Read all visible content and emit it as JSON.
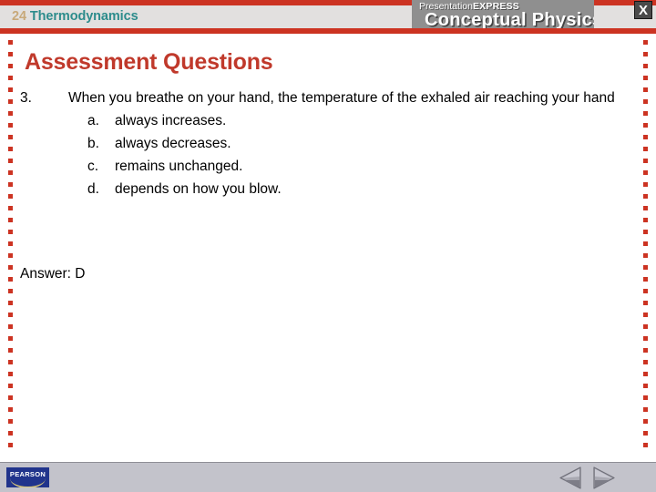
{
  "header": {
    "chapter_number": "24",
    "chapter_name": "Thermodynamics",
    "brand_prefix": "Presentation",
    "brand_suffix": "EXPRESS",
    "brand_product": "Conceptual Physics",
    "close_label": "X",
    "accent_color": "#cc3322",
    "chapter_number_color": "#c8a97a",
    "chapter_name_color": "#2d8c8c",
    "brand_plate_color": "#8f8f8f"
  },
  "slide": {
    "heading": "Assessment Questions",
    "heading_color": "#c0392b",
    "question": {
      "number": "3.",
      "text": "When you breathe on your hand, the temperature of the exhaled air reaching your hand",
      "choices": [
        {
          "letter": "a.",
          "text": "always increases."
        },
        {
          "letter": "b.",
          "text": "always decreases."
        },
        {
          "letter": "c.",
          "text": "remains unchanged."
        },
        {
          "letter": "d.",
          "text": "depends on how you blow."
        }
      ]
    },
    "answer": "Answer: D"
  },
  "footer": {
    "logo_text": "PEARSON",
    "logo_color": "#21348c",
    "background_color": "#c3c3cb",
    "nav_back_label": "Previous slide",
    "nav_next_label": "Next slide"
  }
}
